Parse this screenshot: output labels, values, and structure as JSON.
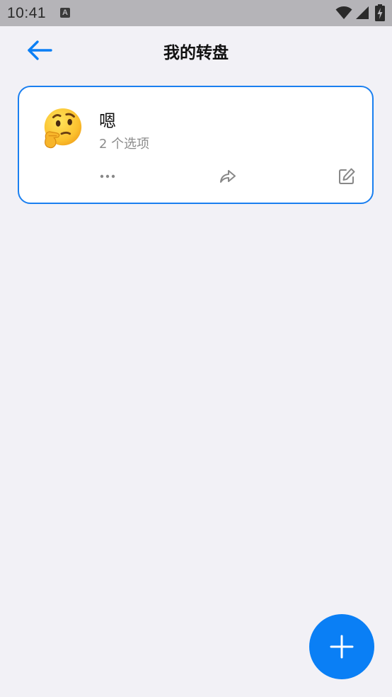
{
  "status_bar": {
    "time": "10:41",
    "notification_icon": "a-square-icon",
    "icons": [
      "wifi-icon",
      "signal-icon",
      "battery-charging-icon"
    ]
  },
  "header": {
    "back_icon": "arrow-left-icon",
    "title": "我的转盘"
  },
  "wheels": [
    {
      "emoji": "thinking-face-emoji",
      "name": "嗯",
      "options_count_text": "2 个选项",
      "actions": [
        "more-dots-icon",
        "share-icon",
        "edit-icon"
      ]
    }
  ],
  "fab": {
    "icon": "plus-icon"
  },
  "colors": {
    "accent": "#0a7ff5",
    "background": "#f2f1f6",
    "status_bar": "#b5b4b8"
  }
}
